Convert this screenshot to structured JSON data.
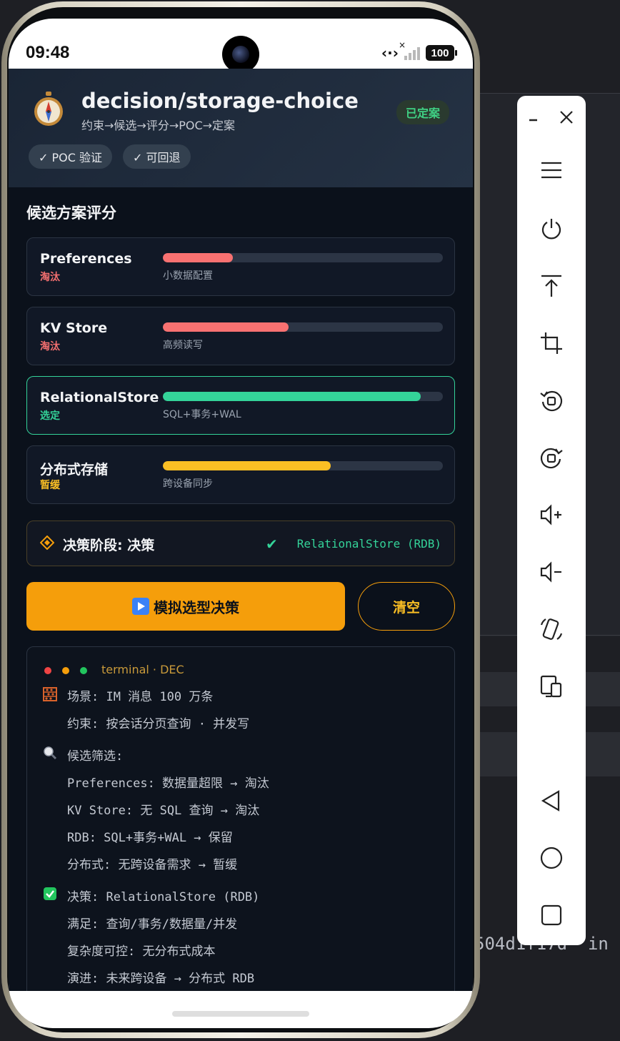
{
  "status_bar": {
    "time": "09:48",
    "battery": "100"
  },
  "header": {
    "title": "decision/storage-choice",
    "subtitle": "约束→候选→评分→POC→定案",
    "badge": "已定案",
    "chips": [
      "✓ POC 验证",
      "✓ 可回退"
    ]
  },
  "section_title": "候选方案评分",
  "candidates": [
    {
      "name": "Preferences",
      "status": "淘汰",
      "desc": "小数据配置",
      "score": 0.25,
      "color": "#f87171",
      "status_color": "#f87171"
    },
    {
      "name": "KV Store",
      "status": "淘汰",
      "desc": "高频读写",
      "score": 0.45,
      "color": "#f87171",
      "status_color": "#f87171"
    },
    {
      "name": "RelationalStore",
      "status": "选定",
      "desc": "SQL+事务+WAL",
      "score": 0.92,
      "color": "#34d399",
      "status_color": "#34d399"
    },
    {
      "name": "分布式存储",
      "status": "暂缓",
      "desc": "跨设备同步",
      "score": 0.6,
      "color": "#fbbf24",
      "status_color": "#fbbf24"
    }
  ],
  "phase": {
    "label": "决策阶段: 决策",
    "result": "RelationalStore (RDB)"
  },
  "actions": {
    "run_label": "模拟选型决策",
    "clear_label": "清空"
  },
  "terminal": {
    "title": "terminal · DEC",
    "lines": [
      "场景: IM 消息 100 万条",
      "约束: 按会话分页查询 · 并发写",
      "候选筛选:",
      "Preferences: 数据量超限 → 淘汰",
      "KV Store: 无 SQL 查询 → 淘汰",
      "RDB: SQL+事务+WAL → 保留",
      "分布式: 无跨设备需求 → 暂缓",
      "决策: RelationalStore (RDB)",
      "满足: 查询/事务/数据量/并发",
      "复杂度可控: 无分布式成本",
      "演进: 未来跨设备 → 分布式 RDB"
    ]
  },
  "background": {
    "text": "504d1f17d' in"
  },
  "colors": {
    "accent": "#f59e0b",
    "success": "#34d399",
    "danger": "#f87171",
    "warning": "#fbbf24"
  }
}
